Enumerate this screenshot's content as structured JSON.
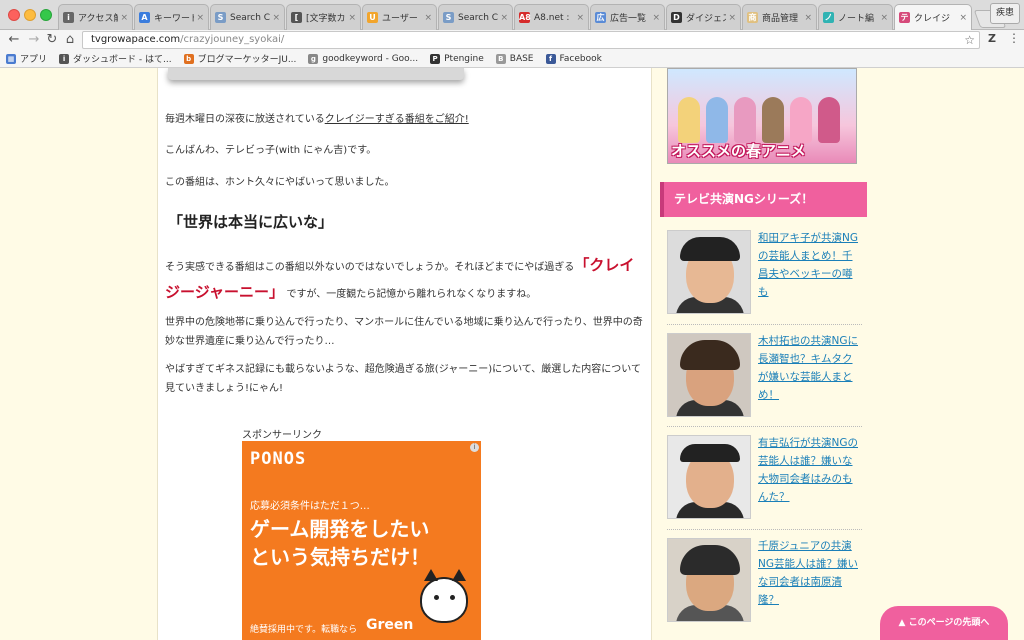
{
  "browser": {
    "tabs": [
      {
        "label": "アクセス解",
        "icon": "i",
        "color": "#666"
      },
      {
        "label": "キーワード",
        "icon": "A",
        "color": "#3b7ddd"
      },
      {
        "label": "Search C",
        "icon": "S",
        "color": "#7a9cc6"
      },
      {
        "label": "[文字数カ",
        "icon": "[",
        "color": "#555"
      },
      {
        "label": "ユーザー",
        "icon": "U",
        "color": "#f2a52c"
      },
      {
        "label": "Search C",
        "icon": "S",
        "color": "#7a9cc6"
      },
      {
        "label": "A8.net : ",
        "icon": "A8",
        "color": "#d62b2b"
      },
      {
        "label": "広告一覧",
        "icon": "広",
        "color": "#5a8bd6"
      },
      {
        "label": "ダイジェス",
        "icon": "D",
        "color": "#333"
      },
      {
        "label": "商品管理",
        "icon": "商",
        "color": "#e0c080"
      },
      {
        "label": "ノート編",
        "icon": "ノ",
        "color": "#30b3b3"
      },
      {
        "label": "クレイジ",
        "icon": "テ",
        "color": "#d64a7a"
      }
    ],
    "tab_close": "×",
    "profile": "疾患",
    "back": "←",
    "forward": "→",
    "reload": "↻",
    "home": "⌂",
    "url_host": "tvgrowapace.com",
    "url_path": "/crazyjouney_syokai/",
    "star": "☆",
    "ext": "Z",
    "menu": "⋮",
    "bookmarks": [
      {
        "label": "アプリ",
        "icon": "▦",
        "color": "#4a7bd0"
      },
      {
        "label": "ダッシュボード - はて...",
        "icon": "i",
        "color": "#555"
      },
      {
        "label": "ブログマーケッターJU...",
        "icon": "b",
        "color": "#e07020"
      },
      {
        "label": "goodkeyword - Goo...",
        "icon": "g",
        "color": "#888"
      },
      {
        "label": "Ptengine",
        "icon": "P",
        "color": "#333"
      },
      {
        "label": "BASE",
        "icon": "B",
        "color": "#999"
      },
      {
        "label": "Facebook",
        "icon": "f",
        "color": "#3b5998"
      }
    ]
  },
  "article": {
    "p1_text": "毎週木曜日の深夜に放送されている",
    "p1_link": "クレイジーすぎる番組をご紹介!",
    "p2": "こんばんわ、テレビっ子(with にゃん吉)です。",
    "p3": "この番組は、ホント久々にやばいって思いました。",
    "heading": "「世界は本当に広いな」",
    "p4_a": "そう実感できる番組はこの番組以外ないのではないでしょうか。それほどまでにやば過ぎる",
    "p4_em": "「クレイジージャーニー」",
    "p4_b": "ですが、一度観たら記憶から離れられなくなりますね。",
    "p5": "世界中の危険地帯に乗り込んで行ったり、マンホールに住んでいる地域に乗り込んで行ったり、世界中の奇妙な世界遺産に乗り込んで行ったり…",
    "p6": "やばすぎてギネス記録にも載らないような、超危険過ぎる旅(ジャーニー)について、厳選した内容について見ていきましょう!にゃん!",
    "sponsor": "スポンサーリンク"
  },
  "ad": {
    "brand": "PONOS",
    "sub": "応募必須条件はただ１つ…",
    "big1": "ゲーム開発をしたい",
    "big2": "という気持ちだけ！",
    "foot": "絶賛採用中です。転職なら",
    "green": "Green",
    "info": "i"
  },
  "sidebar": {
    "banner_caption": "オススメの春アニメ",
    "section_title": "テレビ共演NGシリーズ！",
    "items": [
      {
        "title": "和田アキ子が共演NGの芸能人まとめ！千昌夫やベッキーの噂も"
      },
      {
        "title": "木村拓也の共演NGに長瀬智也？キムタクが嫌いな芸能人まとめ！"
      },
      {
        "title": "有吉弘行が共演NGの芸能人は誰？嫌いな大物司会者はみのもんた？"
      },
      {
        "title": "千原ジュニアの共演NG芸能人は誰？嫌いな司会者は南原清隆？"
      }
    ],
    "to_top": "▲ このページの先頭へ"
  }
}
